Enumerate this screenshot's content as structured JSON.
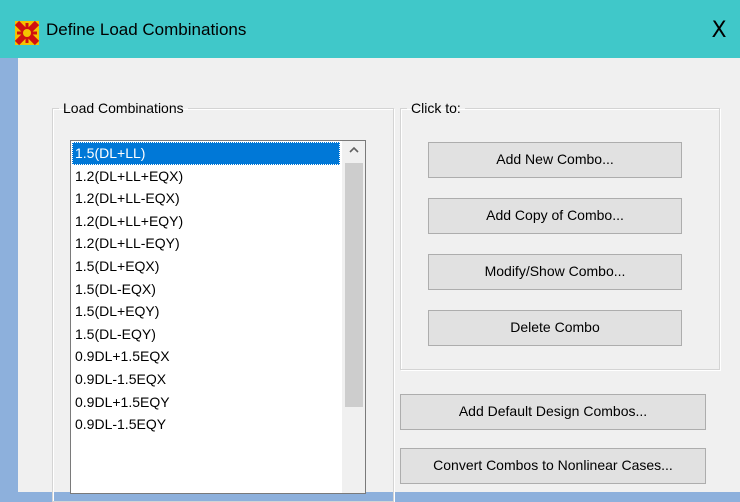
{
  "window": {
    "title": "Define Load Combinations",
    "close_symbol": "X",
    "icon": "sap2000-app-icon"
  },
  "load_combinations": {
    "legend": "Load Combinations",
    "items": [
      "1.5(DL+LL)",
      "1.2(DL+LL+EQX)",
      "1.2(DL+LL-EQX)",
      "1.2(DL+LL+EQY)",
      "1.2(DL+LL-EQY)",
      "1.5(DL+EQX)",
      "1.5(DL-EQX)",
      "1.5(DL+EQY)",
      "1.5(DL-EQY)",
      "0.9DL+1.5EQX",
      "0.9DL-1.5EQX",
      "0.9DL+1.5EQY",
      "0.9DL-1.5EQY"
    ],
    "selected": "1.5(DL+LL)",
    "scroll_up_symbol": "^"
  },
  "click_to": {
    "legend": "Click to:",
    "add_new": "Add New Combo...",
    "add_copy": "Add Copy of Combo...",
    "modify_show": "Modify/Show Combo...",
    "delete": "Delete Combo"
  },
  "extra_buttons": {
    "add_default_design": "Add Default Design Combos...",
    "convert_nonlinear": "Convert Combos to Nonlinear Cases..."
  },
  "colors": {
    "titlebar": "#40c8c9",
    "selection": "#0078d7",
    "dialog_bg": "#f0f0f0"
  }
}
